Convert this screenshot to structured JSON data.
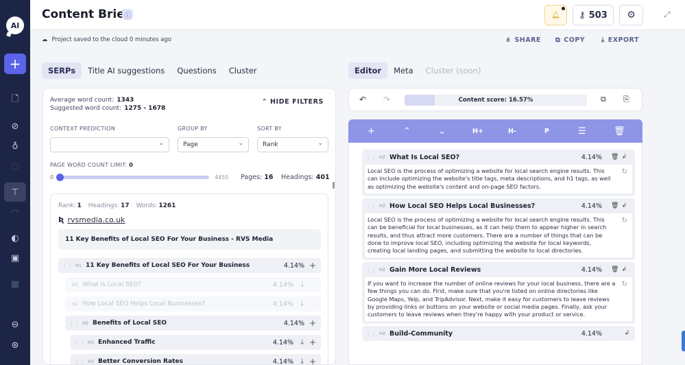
{
  "app": {
    "logo_text": "AI",
    "title": "Content Brief"
  },
  "header": {
    "credits": "503"
  },
  "status": {
    "saved_text": "Project saved to the cloud 0 minutes ago",
    "share": "SHARE",
    "copy": "COPY",
    "export": "EXPORT"
  },
  "left_tabs": [
    "SERPs",
    "Title AI suggestions",
    "Questions",
    "Cluster"
  ],
  "right_tabs": [
    "Editor",
    "Meta",
    "Cluster (soon)"
  ],
  "serps": {
    "avg_word_label": "Average word count:",
    "avg_word_value": "1343",
    "suggested_label": "Suggested word count:",
    "suggested_value": "1275 - 1678",
    "hide_filters": "HIDE FILTERS",
    "context_label": "CONTEXT PREDICTION",
    "context_value": "",
    "group_label": "GROUP BY",
    "group_value": "Page",
    "sort_label": "SORT BY",
    "sort_value": "Rank",
    "limit_label": "PAGE WORD COUNT LIMIT:",
    "limit_value": "0",
    "slider_min": "0",
    "slider_max": "4455",
    "slider_value": 0,
    "pages_label": "Pages:",
    "pages_value": "16",
    "headings_label": "Headings:",
    "headings_value": "401",
    "result": {
      "rank_label": "Rank:",
      "rank": "1",
      "headings_label": "Headings:",
      "headings": "17",
      "words_label": "Words:",
      "words": "1261",
      "domain": "rvsmedia.co.uk",
      "title": "11 Key Benefits of Local SEO For Your Business - RVS Media",
      "outline": [
        {
          "level": "H1",
          "text": "11 Key Benefits of Local SEO For Your Business",
          "pct": "4.14%",
          "faded": false
        },
        {
          "level": "H2",
          "text": "What Is Local SEO?",
          "pct": "4.14%",
          "faded": true
        },
        {
          "level": "H2",
          "text": "How Local SEO Helps Local Businesses?",
          "pct": "4.14%",
          "faded": true
        },
        {
          "level": "H2",
          "text": "Benefits of Local SEO",
          "pct": "4.14%",
          "faded": false
        },
        {
          "level": "H3",
          "text": "Enhanced Traffic",
          "pct": "4.14%",
          "faded": false
        },
        {
          "level": "H3",
          "text": "Better Conversion Rates",
          "pct": "4.14%",
          "faded": false
        }
      ]
    }
  },
  "editor": {
    "score_text": "Content score: 16.57%",
    "score_value": 16.57,
    "toolbar": {
      "h_plus": "H+",
      "h_minus": "H-",
      "p": "P"
    },
    "blocks": [
      {
        "level": "H2",
        "title": "What Is Local SEO?",
        "pct": "4.14%",
        "body": "Local SEO is the process of optimizing a website for local search engine results. This can include optimizing the website's title tags, meta descriptions, and h1 tags, as well as optimizing the website's content and on-page SEO factors."
      },
      {
        "level": "H2",
        "title": "How Local SEO Helps Local Businesses?",
        "pct": "4.14%",
        "body": "Local SEO is the process of optimizing a website for local search engine results. This can be beneficial for local businesses, as it can help them to appear higher in search results, and thus attract more customers. There are a number of things that can be done to improve local SEO, including optimizing the website for local keywords, creating local landing pages, and submitting the website to local directories."
      },
      {
        "level": "H2",
        "title": "Gain More Local Reviews",
        "pct": "4.14%",
        "body": "If you want to increase the number of online reviews for your local business, there are a few things you can do. First, make sure that you're listed on online directories like Google Maps, Yelp, and TripAdvisor. Next, make it easy for customers to leave reviews by providing links or buttons on your website or social media pages. Finally, ask your customers to leave reviews when they're happy with your product or service."
      },
      {
        "level": "H2",
        "title": "Build-Community",
        "pct": "4.14%",
        "body": ""
      }
    ]
  }
}
